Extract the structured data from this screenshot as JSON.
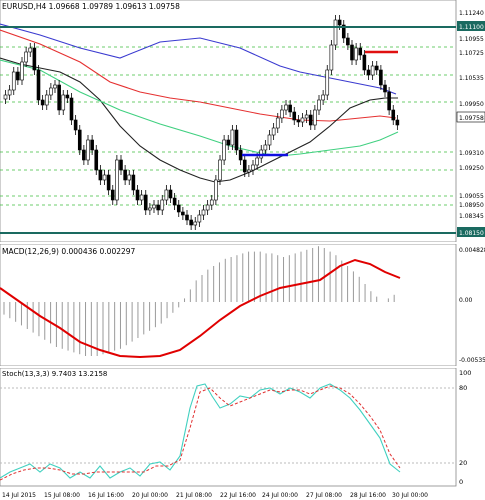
{
  "window": {
    "symbol_info": "EURUSD,H4  1.09668 1.09789 1.09613 1.09758"
  },
  "price_panel": {
    "axis_labels": [
      "1.11240",
      "1.11100",
      "1.10955",
      "1.10725",
      "1.10535",
      "1.09950",
      "1.09758",
      "1.09310",
      "1.09250",
      "1.09055",
      "1.08950",
      "1.08345",
      "1.08150"
    ],
    "current_price": "1.09758",
    "key_level_labels": [
      "1.11100",
      "1.08150"
    ],
    "colors": {
      "candle": "#000000",
      "ma_red": "#e53030",
      "ma_blue": "#3a3ad0",
      "ma_black": "#222222",
      "ma_green": "#40d080",
      "key_level": "#1a6a60",
      "fib_dash": "#3dbf3d",
      "marker_blue": "#1010e0",
      "marker_red": "#e01010"
    }
  },
  "macd_panel": {
    "title": "MACD(12,26,9) 0.000436 0.002297",
    "axis_labels": [
      "0.004828",
      "0.00",
      "-0.005351"
    ],
    "colors": {
      "signal": "#e00000",
      "histogram": "#9a9a9a"
    }
  },
  "stoch_panel": {
    "title": "Stoch(13,3,3) 9.7403 13.2158",
    "axis_labels": [
      "100",
      "80",
      "20",
      "0"
    ],
    "colors": {
      "main": "#40d0c0",
      "signal": "#e03030"
    }
  },
  "time_axis": {
    "labels": [
      "14 Jul 2015",
      "15 Jul 08:00",
      "16 Jul 16:00",
      "20 Jul 00:00",
      "21 Jul 08:00",
      "22 Jul 16:00",
      "24 Jul 00:00",
      "27 Jul 08:00",
      "28 Jul 16:00",
      "30 Jul 00:00"
    ]
  }
}
